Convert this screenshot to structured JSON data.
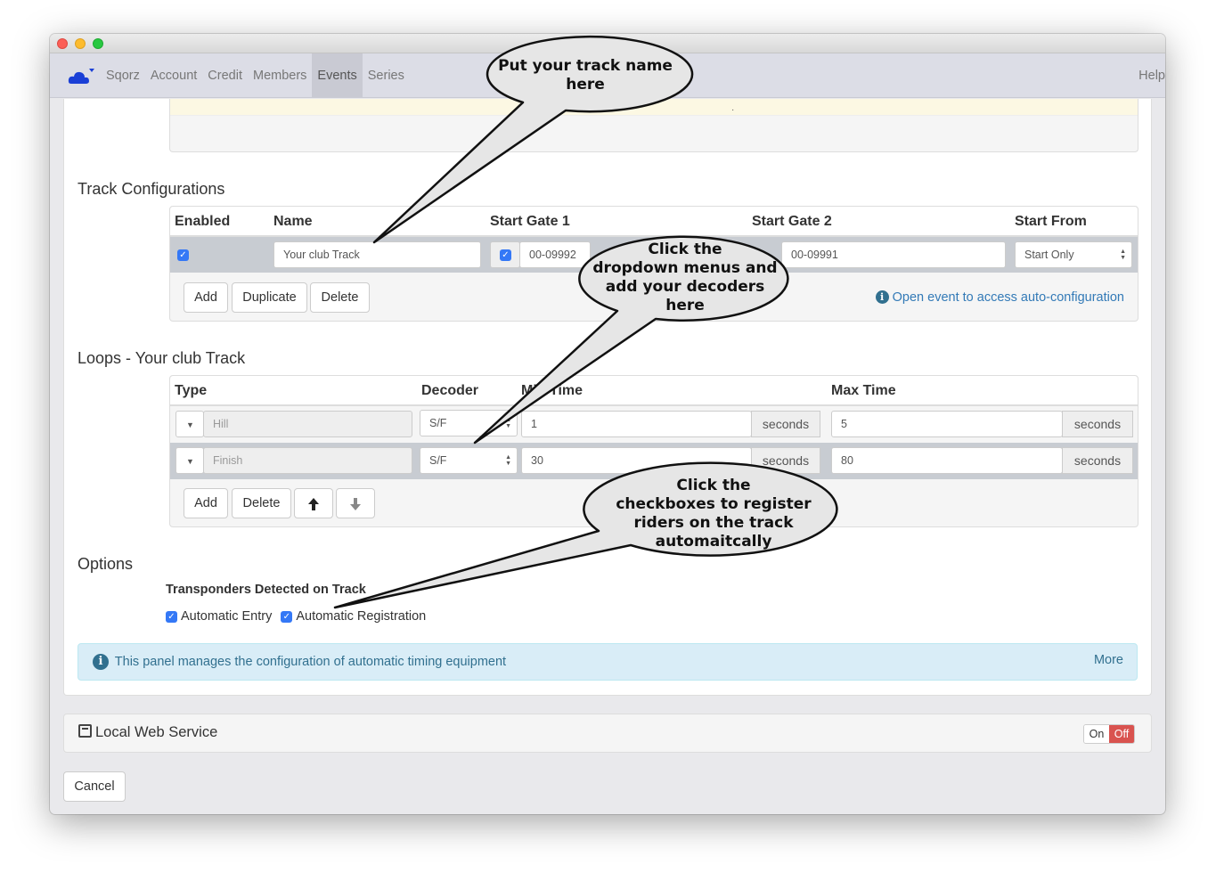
{
  "window": {
    "title": "Sqorz"
  },
  "nav": {
    "items": [
      "Sqorz",
      "Account",
      "Credit",
      "Members",
      "Events",
      "Series"
    ],
    "active": "Events",
    "help": "Help"
  },
  "track_config": {
    "heading": "Track Configurations",
    "columns": {
      "enabled": "Enabled",
      "name": "Name",
      "gate1": "Start Gate 1",
      "gate2": "Start Gate 2",
      "start_from": "Start From"
    },
    "row": {
      "enabled": true,
      "name": "Your club Track",
      "gate1_checked": true,
      "gate1": "00-09992",
      "gate2": "00-09991",
      "start_from": "Start Only"
    },
    "buttons": {
      "add": "Add",
      "duplicate": "Duplicate",
      "delete": "Delete"
    },
    "auto_config_link": "Open event to access auto-configuration"
  },
  "loops": {
    "heading": "Loops - Your club Track",
    "columns": {
      "type": "Type",
      "decoder": "Decoder",
      "min_time": "Min Time",
      "max_time": "Max Time"
    },
    "rows": [
      {
        "type": "Hill",
        "decoder": "S/F",
        "min": "1",
        "min_unit": "seconds",
        "max": "5",
        "max_unit": "seconds"
      },
      {
        "type": "Finish",
        "decoder": "S/F",
        "min": "30",
        "min_unit": "seconds",
        "max": "80",
        "max_unit": "seconds"
      }
    ],
    "buttons": {
      "add": "Add",
      "delete": "Delete"
    }
  },
  "options": {
    "heading": "Options",
    "group_label": "Transponders Detected on Track",
    "auto_entry": "Automatic Entry",
    "auto_registration": "Automatic Registration"
  },
  "alert": {
    "text": "This panel manages the configuration of automatic timing equipment",
    "more": "More"
  },
  "local_web_service": {
    "title": "Local Web Service",
    "on": "On",
    "off": "Off"
  },
  "cancel": "Cancel",
  "callouts": {
    "track_name": [
      "Put your track name",
      "here"
    ],
    "decoders": [
      "Click the",
      "dropdown menus and",
      "add your decoders",
      "here"
    ],
    "checkboxes": [
      "Click the",
      "checkboxes to register",
      "riders on the track",
      "automaitcally"
    ]
  },
  "colors": {
    "accent": "#337ab7",
    "checkbox": "#3478f6",
    "off": "#d9534f",
    "alert_bg": "#d9edf7"
  }
}
